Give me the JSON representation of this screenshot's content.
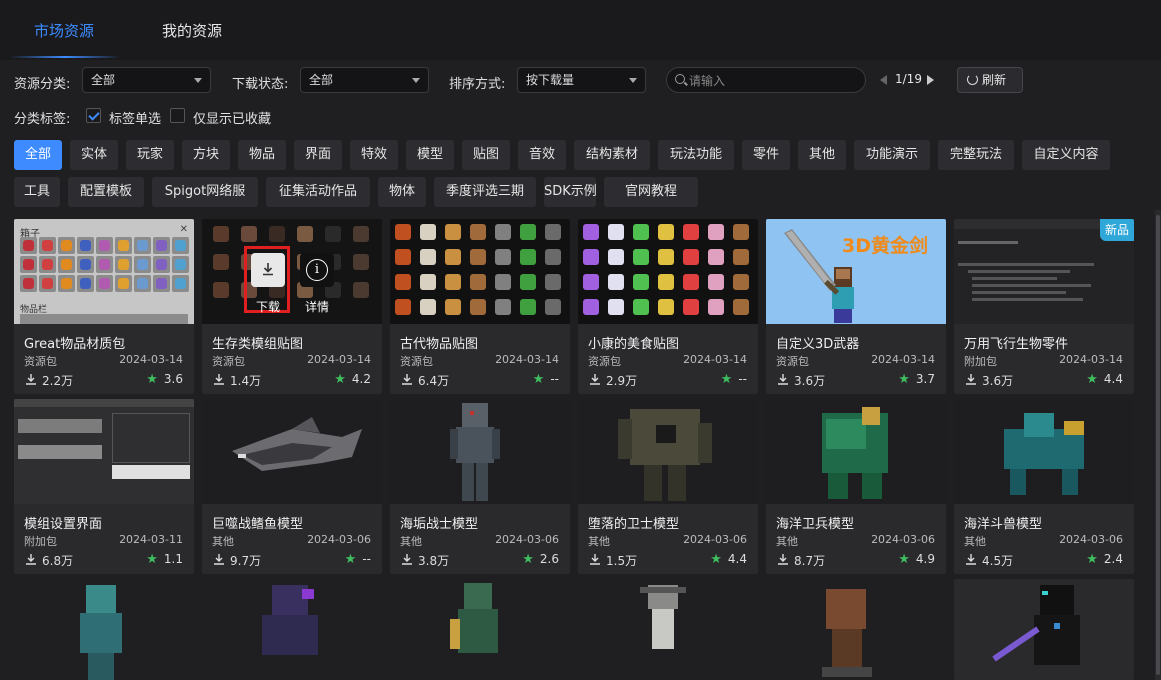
{
  "tabs": [
    {
      "label": "市场资源",
      "active": true
    },
    {
      "label": "我的资源",
      "active": false
    }
  ],
  "filters": {
    "category_label": "资源分类:",
    "category_value": "全部",
    "download_state_label": "下载状态:",
    "download_state_value": "全部",
    "sort_label": "排序方式:",
    "sort_value": "按下载量",
    "search_placeholder": "请输入",
    "page": "1/19",
    "refresh_label": "刷新"
  },
  "tag_options": {
    "label": "分类标签:",
    "single_select_label": "标签单选",
    "single_select_checked": true,
    "favorites_only_label": "仅显示已收藏",
    "favorites_only_checked": false
  },
  "tags_row1": [
    "全部",
    "实体",
    "玩家",
    "方块",
    "物品",
    "界面",
    "特效",
    "模型",
    "贴图",
    "音效",
    "结构素材",
    "玩法功能",
    "零件",
    "其他",
    "功能演示",
    "完整玩法",
    "自定义内容"
  ],
  "tags_row2": [
    "工具",
    "配置模板",
    "Spigot网络服",
    "征集活动作品",
    "物体",
    "季度评选三期",
    "SDK示例",
    "官网教程"
  ],
  "active_tag": "全部",
  "hover_actions": {
    "download": "下载",
    "details": "详情"
  },
  "thumb_text": {
    "box_title": "箱子",
    "box_footer": "物品栏",
    "sword_caption": "3D黄金剑",
    "new_badge": "新品"
  },
  "cards_row1": [
    {
      "title": "Great物品材质包",
      "category": "资源包",
      "date": "2024-03-14",
      "downloads": "2.2万",
      "rating": "3.6"
    },
    {
      "title": "生存类模组贴图",
      "category": "资源包",
      "date": "2024-03-14",
      "downloads": "1.4万",
      "rating": "4.2"
    },
    {
      "title": "古代物品贴图",
      "category": "资源包",
      "date": "2024-03-14",
      "downloads": "6.4万",
      "rating": "--"
    },
    {
      "title": "小康的美食贴图",
      "category": "资源包",
      "date": "2024-03-14",
      "downloads": "2.9万",
      "rating": "--"
    },
    {
      "title": "自定义3D武器",
      "category": "资源包",
      "date": "2024-03-14",
      "downloads": "3.6万",
      "rating": "3.7"
    },
    {
      "title": "万用飞行生物零件",
      "category": "附加包",
      "date": "2024-03-14",
      "downloads": "3.6万",
      "rating": "4.4"
    }
  ],
  "cards_row2": [
    {
      "title": "模组设置界面",
      "category": "附加包",
      "date": "2024-03-11",
      "downloads": "6.8万",
      "rating": "1.1"
    },
    {
      "title": "巨噬战鳍鱼模型",
      "category": "其他",
      "date": "2024-03-06",
      "downloads": "9.7万",
      "rating": "--"
    },
    {
      "title": "海垢战士模型",
      "category": "其他",
      "date": "2024-03-06",
      "downloads": "3.8万",
      "rating": "2.6"
    },
    {
      "title": "堕落的卫士模型",
      "category": "其他",
      "date": "2024-03-06",
      "downloads": "1.5万",
      "rating": "4.4"
    },
    {
      "title": "海洋卫兵模型",
      "category": "其他",
      "date": "2024-03-06",
      "downloads": "8.7万",
      "rating": "4.9"
    },
    {
      "title": "海洋斗兽模型",
      "category": "其他",
      "date": "2024-03-06",
      "downloads": "4.5万",
      "rating": "2.4"
    }
  ],
  "colors": {
    "accent": "#3d8bff",
    "star": "#3fbf5f",
    "highlight": "#e02020"
  }
}
